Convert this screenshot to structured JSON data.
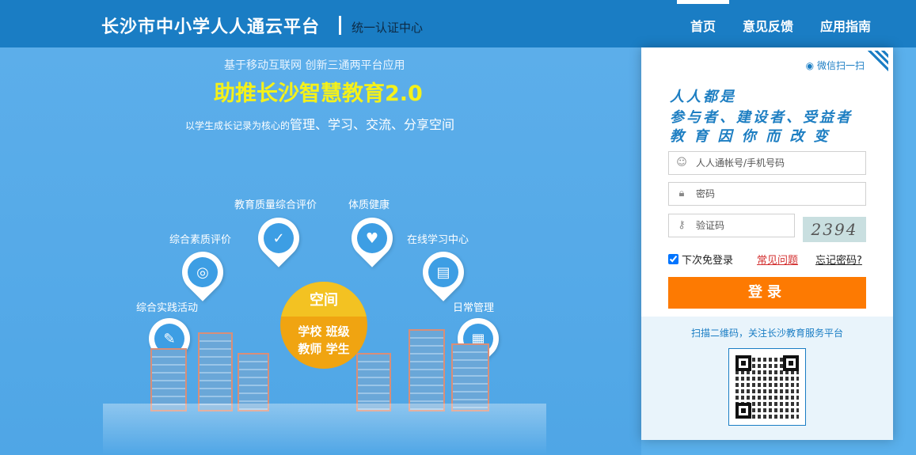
{
  "header": {
    "title": "长沙市中小学人人通云平台",
    "subtitle": "统一认证中心",
    "nav": [
      {
        "label": "首页",
        "active": true
      },
      {
        "label": "意见反馈",
        "active": false
      },
      {
        "label": "应用指南",
        "active": false
      }
    ]
  },
  "hero": {
    "tagline": "基于移动互联网    创新三通两平台应用",
    "slogan": "助推长沙智慧教育2.0",
    "desc_small": "以学生成长记录为核心的",
    "desc_big": "管理、学习、交流、分享空间",
    "features": [
      {
        "label": "教育质量综合评价",
        "icon": "shield-check-icon"
      },
      {
        "label": "体质健康",
        "icon": "heart-pulse-icon"
      },
      {
        "label": "综合素质评价",
        "icon": "globe-icon"
      },
      {
        "label": "在线学习中心",
        "icon": "book-icon"
      },
      {
        "label": "综合实践活动",
        "icon": "tools-icon"
      },
      {
        "label": "日常管理",
        "icon": "calendar-icon"
      }
    ],
    "space": {
      "title": "空间",
      "row1": "学校 班级",
      "row2": "教师 学生"
    }
  },
  "login": {
    "wechat_scan": "微信扫一扫",
    "motto_line1": "人人都是",
    "motto_line2": "参与者、建设者、受益者",
    "motto_line3": "教 育 因 你 而 改 变",
    "account_placeholder": "人人通帐号/手机号码",
    "password_placeholder": "密码",
    "captcha_placeholder": "验证码",
    "captcha_text": "2394",
    "remember_label": "下次免登录",
    "remember_checked": true,
    "faq_link": "常见问题",
    "forgot_link": "忘记密码?",
    "login_button": "登录",
    "qr_tip": "扫描二维码，关注长沙教育服务平台"
  },
  "colors": {
    "header_bg": "#1a7dc4",
    "hero_bg": "#5ab0ec",
    "slogan": "#f4f11a",
    "login_button": "#fd7a02",
    "motto": "#1d7ec2"
  }
}
